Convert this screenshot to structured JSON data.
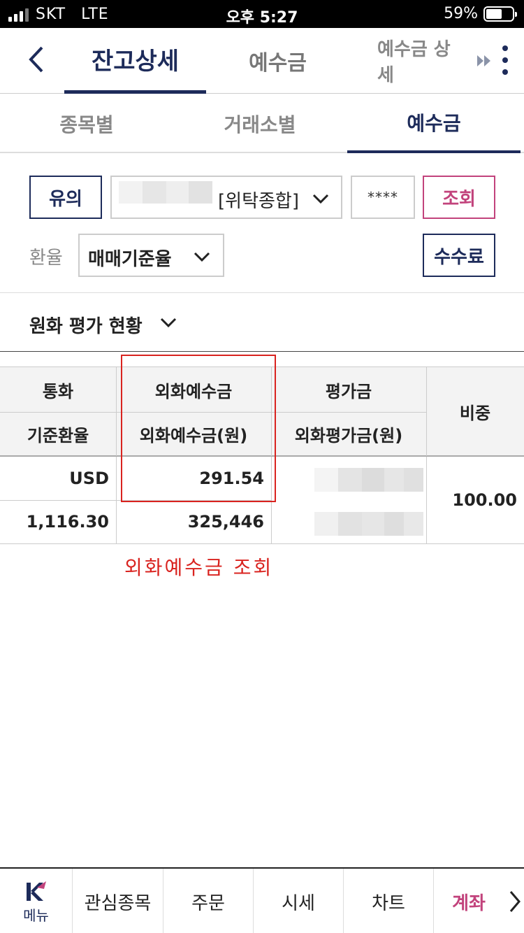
{
  "status_bar": {
    "carrier": "SKT",
    "network": "LTE",
    "time": "오후 5:27",
    "battery": "59%"
  },
  "top_nav": {
    "tabs": [
      "잔고상세",
      "예수금",
      "예수금 상세"
    ]
  },
  "sub_tabs": [
    "종목별",
    "거래소별",
    "예수금"
  ],
  "controls": {
    "notice_button": "유의",
    "account_type": "[위탁종합]",
    "password_mask": "****",
    "query_button": "조회",
    "rate_label": "환율",
    "rate_value": "매매기준율",
    "fee_button": "수수료"
  },
  "section": {
    "title": "원화 평가 현황"
  },
  "table": {
    "headers": {
      "currency": "통화",
      "fx_deposit": "외화예수금",
      "valuation": "평가금",
      "weight": "비중",
      "base_rate": "기준환율",
      "fx_deposit_krw": "외화예수금(원)",
      "fx_valuation_krw": "외화평가금(원)"
    },
    "row": {
      "currency": "USD",
      "fx_deposit": "291.54",
      "base_rate": "1,116.30",
      "fx_deposit_krw": "325,446",
      "weight": "100.00"
    }
  },
  "annotation": "외화예수금 조회",
  "bottom_bar": {
    "menu_label": "메뉴",
    "items": [
      "관심종목",
      "주문",
      "시세",
      "차트",
      "계좌"
    ]
  },
  "colors": {
    "navy": "#1d2b5a",
    "accent_pink": "#c2437c",
    "annotation_red": "#d9231f"
  }
}
